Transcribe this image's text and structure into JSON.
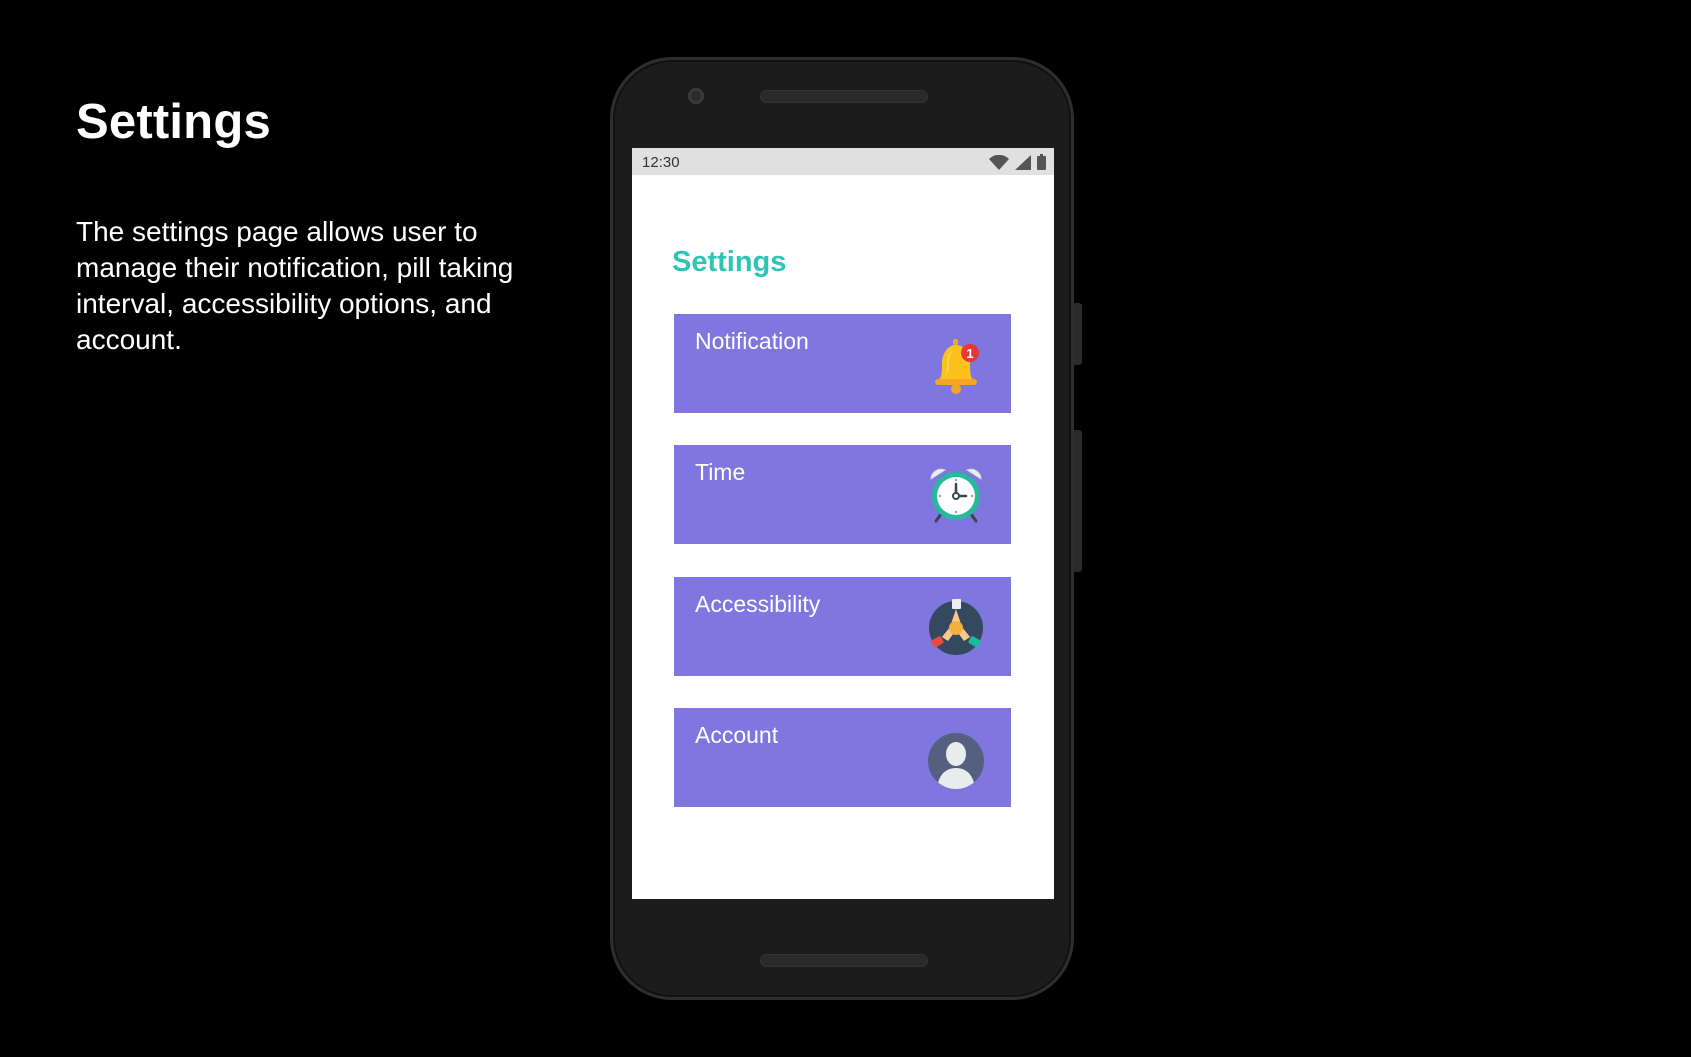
{
  "slide": {
    "title": "Settings",
    "description": "The settings page allows user to manage their notification, pill taking interval, accessibility options, and account."
  },
  "status_bar": {
    "time": "12:30",
    "icons": [
      "wifi-icon",
      "signal-icon",
      "battery-icon"
    ]
  },
  "screen": {
    "title": "Settings",
    "title_color": "#2ec4b6"
  },
  "settings_items": [
    {
      "label": "Notification",
      "icon": "bell-icon",
      "badge": "1"
    },
    {
      "label": "Time",
      "icon": "alarm-clock-icon"
    },
    {
      "label": "Accessibility",
      "icon": "accessibility-hands-icon"
    },
    {
      "label": "Account",
      "icon": "user-avatar-icon"
    }
  ],
  "colors": {
    "card_background": "#7f76e0",
    "background": "#000000",
    "screen_background": "#ffffff"
  }
}
